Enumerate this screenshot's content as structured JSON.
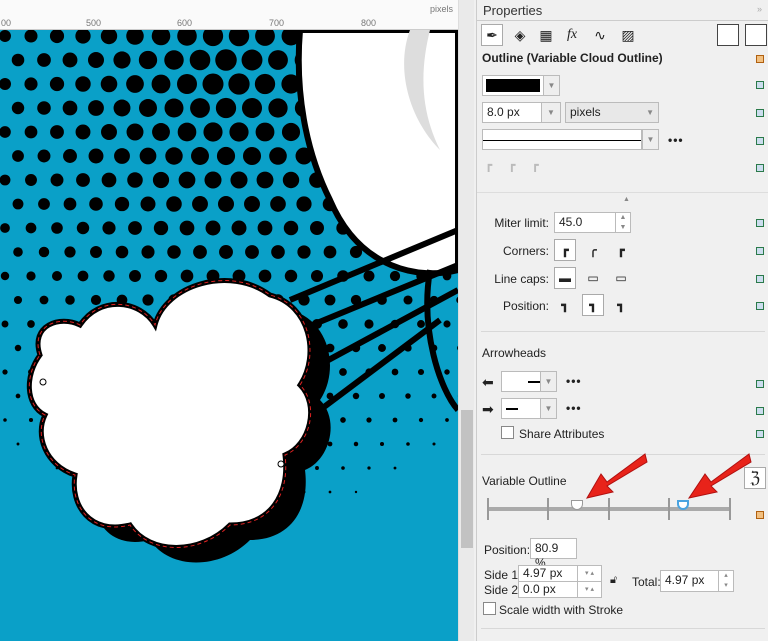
{
  "ruler": {
    "labels": [
      "00",
      "500",
      "600",
      "700",
      "800"
    ],
    "unit": "pixels"
  },
  "canvas": {
    "background_color": "#0aa0c8"
  },
  "panel": {
    "title": "Properties",
    "tabs": [
      "outline-pen-icon",
      "fill-icon",
      "transparency-icon",
      "effects-fx-icon",
      "curve-icon",
      "image-icon"
    ],
    "section_title": "Outline (Variable Cloud Outline)",
    "color": "#000000",
    "width": "8.0 px",
    "units": "pixels",
    "more": "•••",
    "miter_label": "Miter limit:",
    "miter_value": "45.0",
    "corners_label": "Corners:",
    "linecaps_label": "Line caps:",
    "position_label": "Position:",
    "arrowheads_title": "Arrowheads",
    "share_attributes": "Share Attributes",
    "share_checked": false,
    "variable_title": "Variable Outline",
    "nodes": [
      {
        "position_pct": 25,
        "selected": false
      },
      {
        "position_pct": 80.9,
        "selected": true
      }
    ],
    "var_position_label": "Position:",
    "var_position_value": "80.9 %",
    "side1_label": "Side 1:",
    "side1_value": "4.97 px",
    "side2_label": "Side 2:",
    "side2_value": "0.0 px",
    "total_label": "Total:",
    "total_value": "4.97 px",
    "scale_label": "Scale width with Stroke",
    "scale_checked": false,
    "annotation_color": "#e8231a"
  }
}
